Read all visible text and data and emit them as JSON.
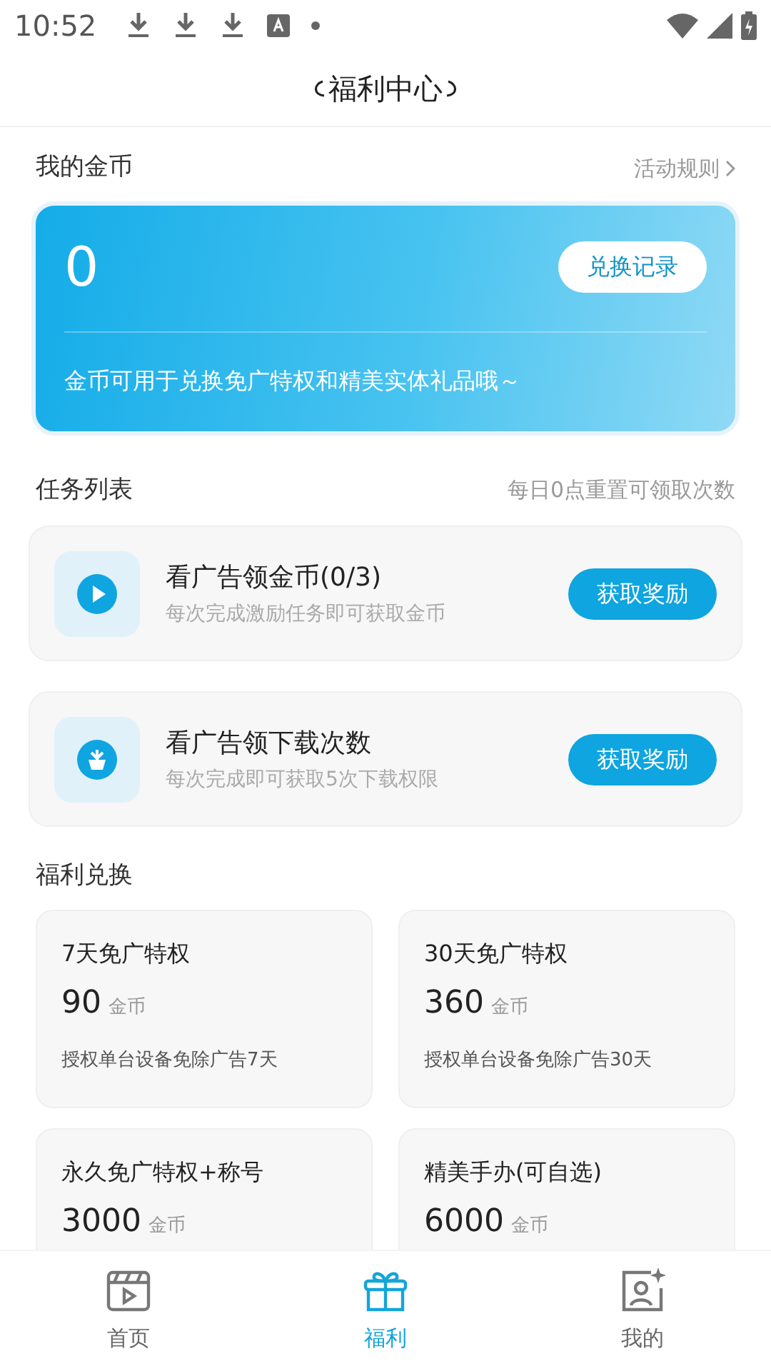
{
  "status_bar": {
    "time": "10:52"
  },
  "header": {
    "title": "福利中心"
  },
  "coins": {
    "label": "我的金币",
    "rules_link": "活动规则",
    "balance": "0",
    "history_button": "兑换记录",
    "note": "金币可用于兑换免广特权和精美实体礼品哦～"
  },
  "tasks": {
    "title": "任务列表",
    "hint": "每日0点重置可领取次数",
    "items": [
      {
        "kind": "play",
        "title": "看广告领金币(0/3)",
        "subtitle": "每次完成激励任务即可获取金币",
        "button": "获取奖励"
      },
      {
        "kind": "plant",
        "title": "看广告领下载次数",
        "subtitle": "每次完成即可获取5次下载权限",
        "button": "获取奖励"
      }
    ]
  },
  "rewards": {
    "title": "福利兑换",
    "items": [
      {
        "name": "7天免广特权",
        "price": "90",
        "unit": "金币",
        "description": "授权单台设备免除广告7天"
      },
      {
        "name": "30天免广特权",
        "price": "360",
        "unit": "金币",
        "description": "授权单台设备免除广告30天"
      },
      {
        "name": "永久免广特权+称号",
        "price": "3000",
        "unit": "金币"
      },
      {
        "name": "精美手办(可自选)",
        "price": "6000",
        "unit": "金币"
      }
    ]
  },
  "bottom_nav": [
    {
      "kind": "home",
      "label": "首页",
      "selected": false
    },
    {
      "kind": "gift",
      "label": "福利",
      "selected": true
    },
    {
      "kind": "profile",
      "label": "我的",
      "selected": false
    }
  ]
}
